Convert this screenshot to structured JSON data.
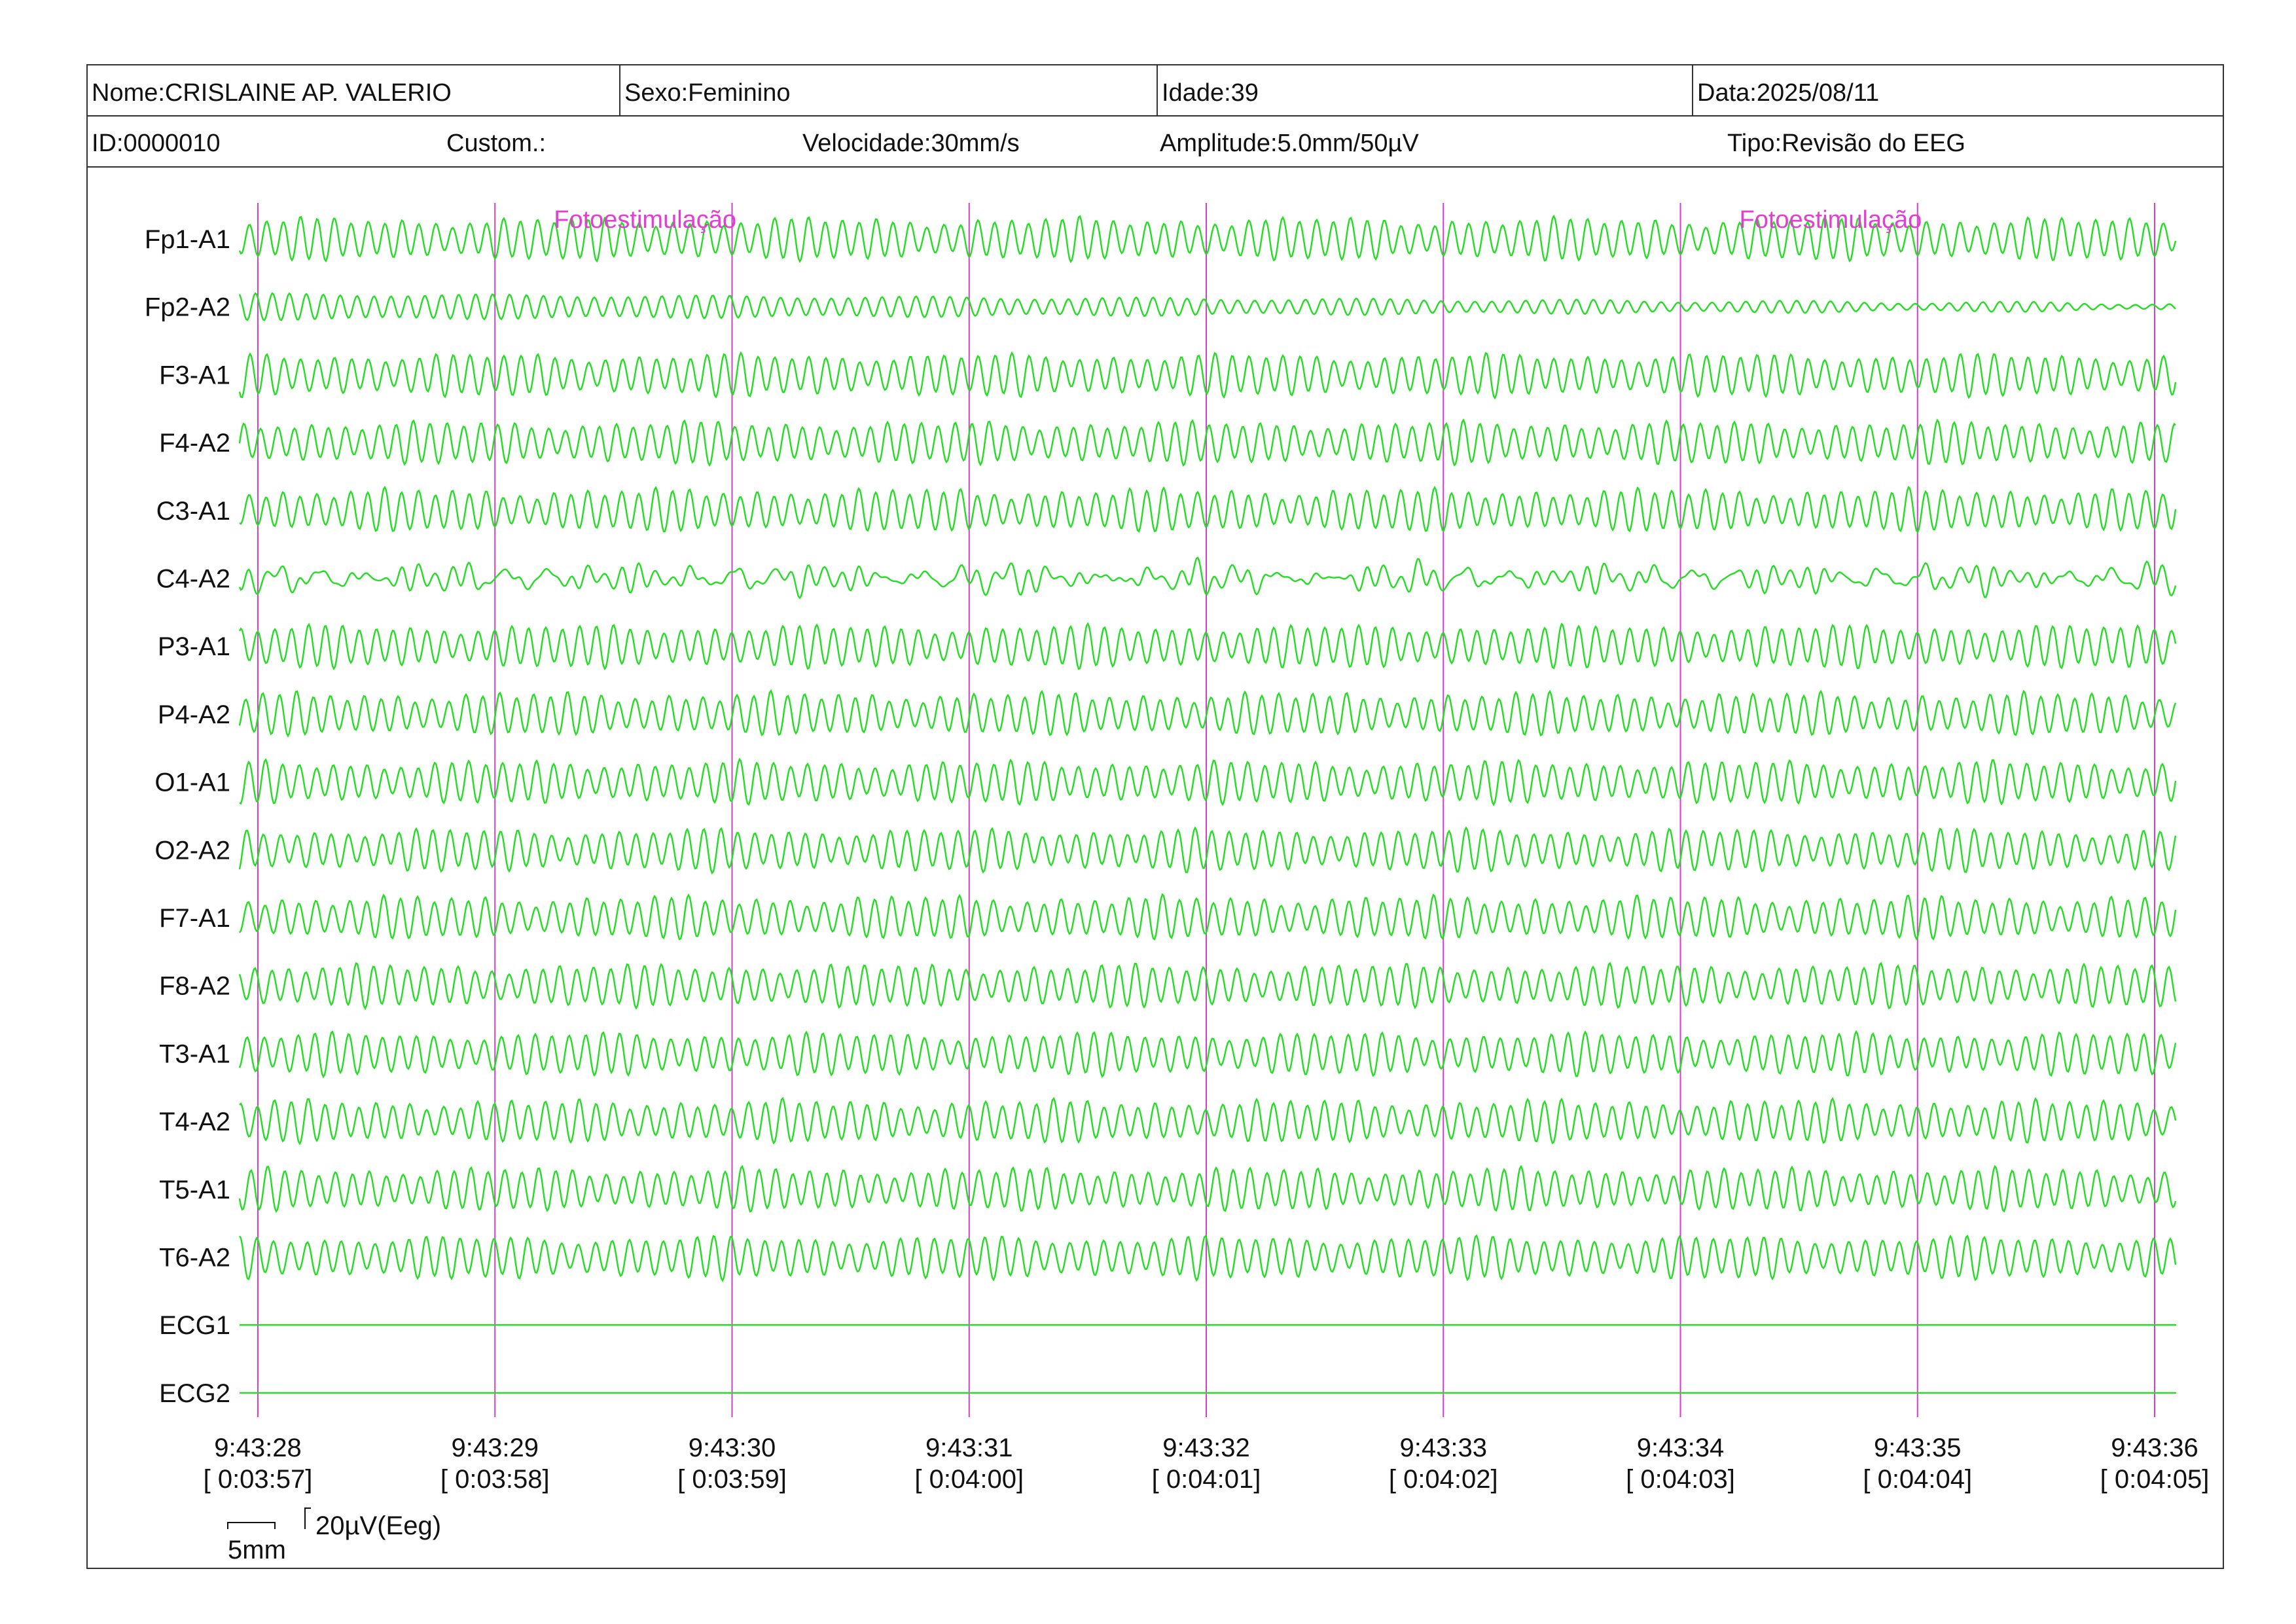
{
  "header": {
    "nome": "Nome:CRISLAINE AP. VALERIO",
    "sexo": "Sexo:Feminino",
    "idade": "Idade:39",
    "data": "Data:2025/08/11",
    "id": "ID:0000010",
    "custom": "Custom.:",
    "velocidade": "Velocidade:30mm/s",
    "amplitude": "Amplitude:5.0mm/50µV",
    "tipo": "Tipo:Revisão do EEG"
  },
  "scale_bar": {
    "time_label": "5mm",
    "amplitude_label": "20µV(Eeg)"
  },
  "colors": {
    "trace": "#22dd22",
    "marker": "#d040c8",
    "annotation": "#e040d0",
    "frame": "#333333"
  },
  "chart_data": {
    "type": "line",
    "channels": [
      "Fp1-A1",
      "Fp2-A2",
      "F3-A1",
      "F4-A2",
      "C3-A1",
      "C4-A2",
      "P3-A1",
      "P4-A2",
      "O1-A1",
      "O2-A2",
      "F7-A1",
      "F8-A2",
      "T3-A1",
      "T4-A2",
      "T5-A1",
      "T6-A2",
      "ECG1",
      "ECG2"
    ],
    "channel_character": [
      "rhythmic",
      "rhythmic-decreasing",
      "rhythmic",
      "rhythmic",
      "rhythmic",
      "irregular-low",
      "rhythmic",
      "rhythmic",
      "rhythmic",
      "rhythmic",
      "rhythmic",
      "rhythmic",
      "rhythmic",
      "rhythmic",
      "rhythmic",
      "rhythmic",
      "flat",
      "flat"
    ],
    "time_ticks": [
      {
        "clock": "9:43:28",
        "elapsed": "[ 0:03:57]"
      },
      {
        "clock": "9:43:29",
        "elapsed": "[ 0:03:58]"
      },
      {
        "clock": "9:43:30",
        "elapsed": "[ 0:03:59]"
      },
      {
        "clock": "9:43:31",
        "elapsed": "[ 0:04:00]"
      },
      {
        "clock": "9:43:32",
        "elapsed": "[ 0:04:01]"
      },
      {
        "clock": "9:43:33",
        "elapsed": "[ 0:04:02]"
      },
      {
        "clock": "9:43:34",
        "elapsed": "[ 0:04:03]"
      },
      {
        "clock": "9:43:35",
        "elapsed": "[ 0:04:04]"
      },
      {
        "clock": "9:43:36",
        "elapsed": "[ 0:04:05]"
      }
    ],
    "annotations": [
      {
        "text": "Fotoestimulação",
        "time": "9:43:29"
      },
      {
        "text": "Fotoestimulação",
        "time": "9:43:34"
      }
    ],
    "cycles_per_second": 14
  }
}
